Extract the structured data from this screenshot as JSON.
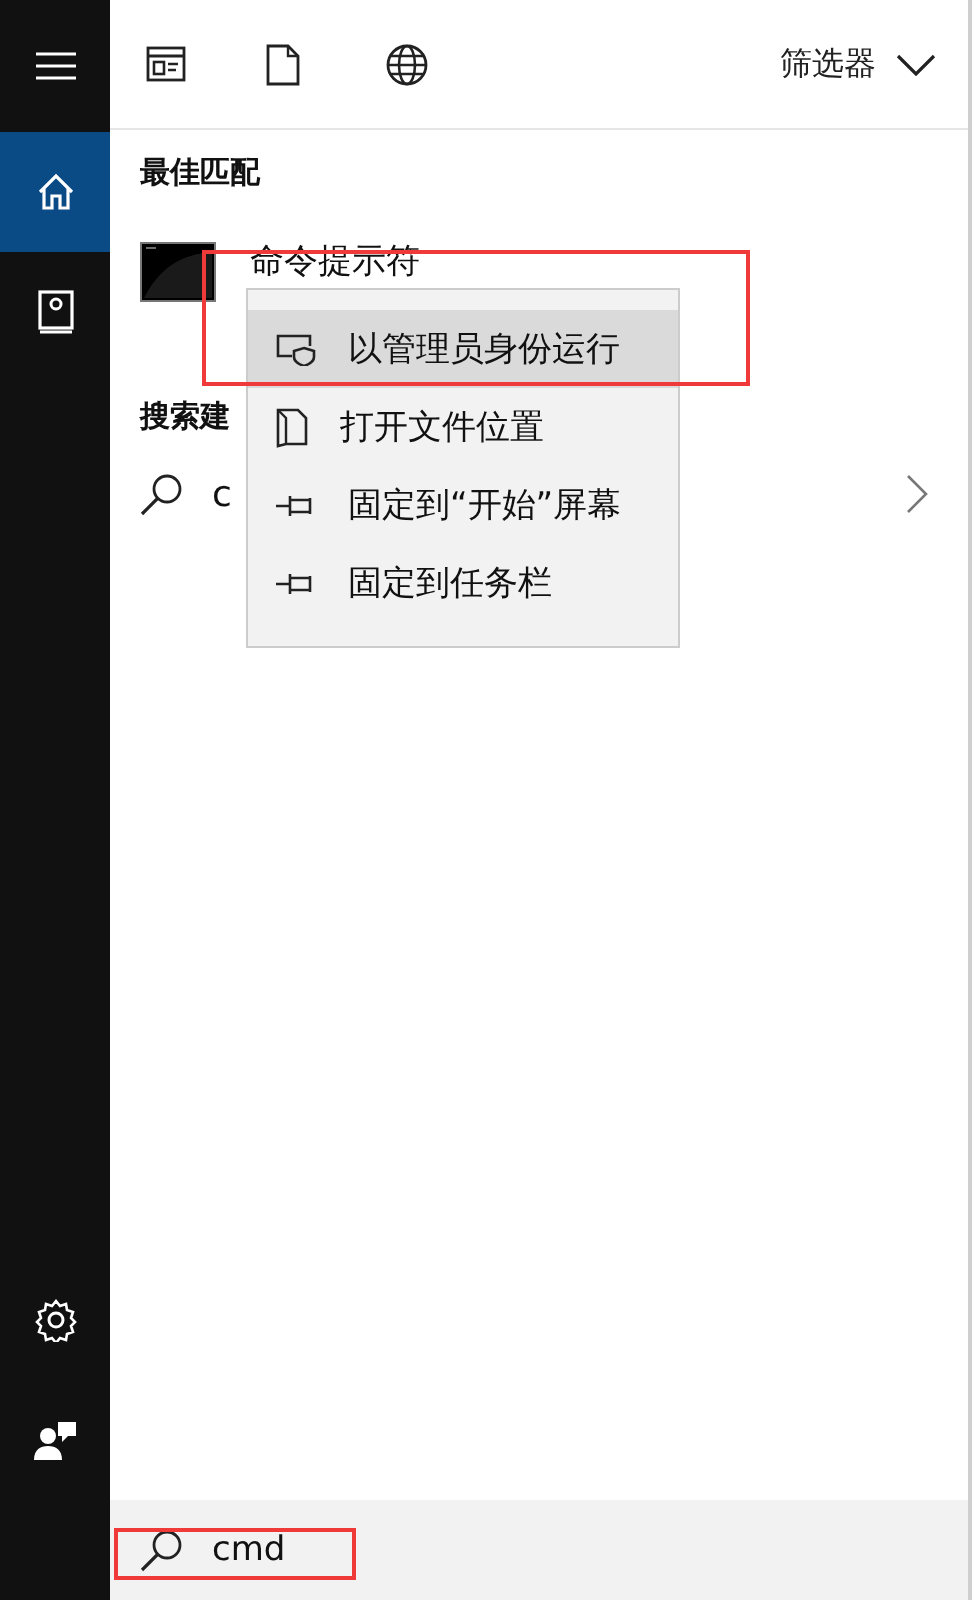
{
  "sidebar": {
    "top_items": [
      {
        "kind": "menu",
        "selected": false
      },
      {
        "kind": "home",
        "selected": true
      },
      {
        "kind": "notebook",
        "selected": false
      }
    ],
    "bottom_items": [
      {
        "kind": "settings"
      },
      {
        "kind": "feedback"
      }
    ]
  },
  "toolbar": {
    "icons": [
      {
        "kind": "apps"
      },
      {
        "kind": "documents"
      },
      {
        "kind": "web"
      }
    ],
    "filter_label": "筛选器"
  },
  "best_match": {
    "heading": "最佳匹配",
    "title": "命令提示符"
  },
  "suggestions": {
    "heading": "搜索建",
    "items": [
      {
        "text": "c"
      }
    ]
  },
  "context_menu": {
    "items": [
      {
        "kind": "admin",
        "label": "以管理员身份运行",
        "selected": true
      },
      {
        "kind": "folder",
        "label": "打开文件位置",
        "selected": false
      },
      {
        "kind": "pin",
        "label": "固定到“开始”屏幕",
        "selected": false
      },
      {
        "kind": "pin",
        "label": "固定到任务栏",
        "selected": false
      }
    ]
  },
  "search": {
    "value": "cmd"
  }
}
